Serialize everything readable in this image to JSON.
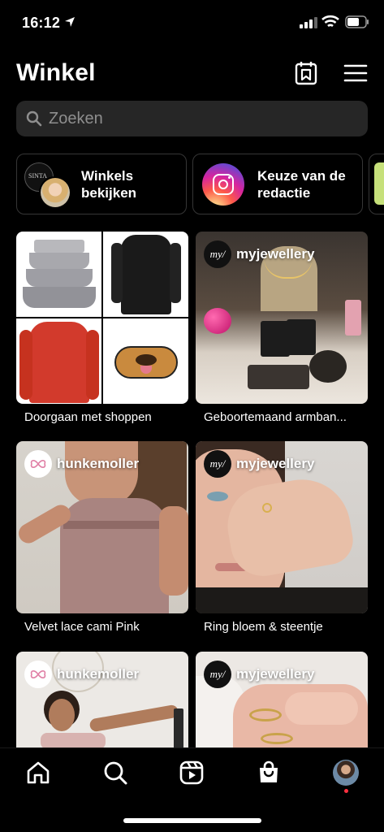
{
  "status_bar": {
    "time": "16:12"
  },
  "header": {
    "title": "Winkel",
    "icons": [
      "saved-collection-icon",
      "menu-icon"
    ]
  },
  "search": {
    "placeholder": "Zoeken"
  },
  "chips": [
    {
      "label": "Winkels bekijken",
      "icon": "shops-avatars-icon"
    },
    {
      "label": "Keuze van de redactie",
      "icon": "instagram-logo-icon"
    }
  ],
  "cards": [
    {
      "caption": "Doorgaan met shoppen"
    },
    {
      "brand": "myjewellery",
      "brand_mark": "my/",
      "caption": "Geboortemaand armban..."
    },
    {
      "brand": "hunkemoller",
      "caption": "Velvet lace cami Pink"
    },
    {
      "brand": "myjewellery",
      "brand_mark": "my/",
      "caption": "Ring bloem & steentje"
    },
    {
      "brand": "hunkemoller",
      "caption": ""
    },
    {
      "brand": "myjewellery",
      "brand_mark": "my/",
      "caption": ""
    }
  ],
  "thumb_labels": {
    "shop_avatar_text": "SINTA"
  },
  "tab_bar": {
    "items": [
      "home-icon",
      "search-icon",
      "reels-icon",
      "shop-icon",
      "profile-avatar"
    ]
  },
  "colors": {
    "background": "#000000",
    "surface": "#262626",
    "notification_dot": "#ff3040"
  }
}
